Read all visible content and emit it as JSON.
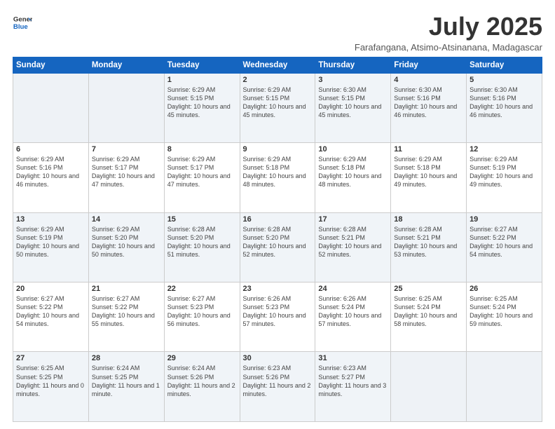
{
  "logo": {
    "line1": "General",
    "line2": "Blue"
  },
  "title": "July 2025",
  "subtitle": "Farafangana, Atsimo-Atsinanana, Madagascar",
  "days_of_week": [
    "Sunday",
    "Monday",
    "Tuesday",
    "Wednesday",
    "Thursday",
    "Friday",
    "Saturday"
  ],
  "weeks": [
    [
      {
        "day": "",
        "info": ""
      },
      {
        "day": "",
        "info": ""
      },
      {
        "day": "1",
        "info": "Sunrise: 6:29 AM\nSunset: 5:15 PM\nDaylight: 10 hours and 45 minutes."
      },
      {
        "day": "2",
        "info": "Sunrise: 6:29 AM\nSunset: 5:15 PM\nDaylight: 10 hours and 45 minutes."
      },
      {
        "day": "3",
        "info": "Sunrise: 6:30 AM\nSunset: 5:15 PM\nDaylight: 10 hours and 45 minutes."
      },
      {
        "day": "4",
        "info": "Sunrise: 6:30 AM\nSunset: 5:16 PM\nDaylight: 10 hours and 46 minutes."
      },
      {
        "day": "5",
        "info": "Sunrise: 6:30 AM\nSunset: 5:16 PM\nDaylight: 10 hours and 46 minutes."
      }
    ],
    [
      {
        "day": "6",
        "info": "Sunrise: 6:29 AM\nSunset: 5:16 PM\nDaylight: 10 hours and 46 minutes."
      },
      {
        "day": "7",
        "info": "Sunrise: 6:29 AM\nSunset: 5:17 PM\nDaylight: 10 hours and 47 minutes."
      },
      {
        "day": "8",
        "info": "Sunrise: 6:29 AM\nSunset: 5:17 PM\nDaylight: 10 hours and 47 minutes."
      },
      {
        "day": "9",
        "info": "Sunrise: 6:29 AM\nSunset: 5:18 PM\nDaylight: 10 hours and 48 minutes."
      },
      {
        "day": "10",
        "info": "Sunrise: 6:29 AM\nSunset: 5:18 PM\nDaylight: 10 hours and 48 minutes."
      },
      {
        "day": "11",
        "info": "Sunrise: 6:29 AM\nSunset: 5:18 PM\nDaylight: 10 hours and 49 minutes."
      },
      {
        "day": "12",
        "info": "Sunrise: 6:29 AM\nSunset: 5:19 PM\nDaylight: 10 hours and 49 minutes."
      }
    ],
    [
      {
        "day": "13",
        "info": "Sunrise: 6:29 AM\nSunset: 5:19 PM\nDaylight: 10 hours and 50 minutes."
      },
      {
        "day": "14",
        "info": "Sunrise: 6:29 AM\nSunset: 5:20 PM\nDaylight: 10 hours and 50 minutes."
      },
      {
        "day": "15",
        "info": "Sunrise: 6:28 AM\nSunset: 5:20 PM\nDaylight: 10 hours and 51 minutes."
      },
      {
        "day": "16",
        "info": "Sunrise: 6:28 AM\nSunset: 5:20 PM\nDaylight: 10 hours and 52 minutes."
      },
      {
        "day": "17",
        "info": "Sunrise: 6:28 AM\nSunset: 5:21 PM\nDaylight: 10 hours and 52 minutes."
      },
      {
        "day": "18",
        "info": "Sunrise: 6:28 AM\nSunset: 5:21 PM\nDaylight: 10 hours and 53 minutes."
      },
      {
        "day": "19",
        "info": "Sunrise: 6:27 AM\nSunset: 5:22 PM\nDaylight: 10 hours and 54 minutes."
      }
    ],
    [
      {
        "day": "20",
        "info": "Sunrise: 6:27 AM\nSunset: 5:22 PM\nDaylight: 10 hours and 54 minutes."
      },
      {
        "day": "21",
        "info": "Sunrise: 6:27 AM\nSunset: 5:22 PM\nDaylight: 10 hours and 55 minutes."
      },
      {
        "day": "22",
        "info": "Sunrise: 6:27 AM\nSunset: 5:23 PM\nDaylight: 10 hours and 56 minutes."
      },
      {
        "day": "23",
        "info": "Sunrise: 6:26 AM\nSunset: 5:23 PM\nDaylight: 10 hours and 57 minutes."
      },
      {
        "day": "24",
        "info": "Sunrise: 6:26 AM\nSunset: 5:24 PM\nDaylight: 10 hours and 57 minutes."
      },
      {
        "day": "25",
        "info": "Sunrise: 6:25 AM\nSunset: 5:24 PM\nDaylight: 10 hours and 58 minutes."
      },
      {
        "day": "26",
        "info": "Sunrise: 6:25 AM\nSunset: 5:24 PM\nDaylight: 10 hours and 59 minutes."
      }
    ],
    [
      {
        "day": "27",
        "info": "Sunrise: 6:25 AM\nSunset: 5:25 PM\nDaylight: 11 hours and 0 minutes."
      },
      {
        "day": "28",
        "info": "Sunrise: 6:24 AM\nSunset: 5:25 PM\nDaylight: 11 hours and 1 minute."
      },
      {
        "day": "29",
        "info": "Sunrise: 6:24 AM\nSunset: 5:26 PM\nDaylight: 11 hours and 2 minutes."
      },
      {
        "day": "30",
        "info": "Sunrise: 6:23 AM\nSunset: 5:26 PM\nDaylight: 11 hours and 2 minutes."
      },
      {
        "day": "31",
        "info": "Sunrise: 6:23 AM\nSunset: 5:27 PM\nDaylight: 11 hours and 3 minutes."
      },
      {
        "day": "",
        "info": ""
      },
      {
        "day": "",
        "info": ""
      }
    ]
  ]
}
